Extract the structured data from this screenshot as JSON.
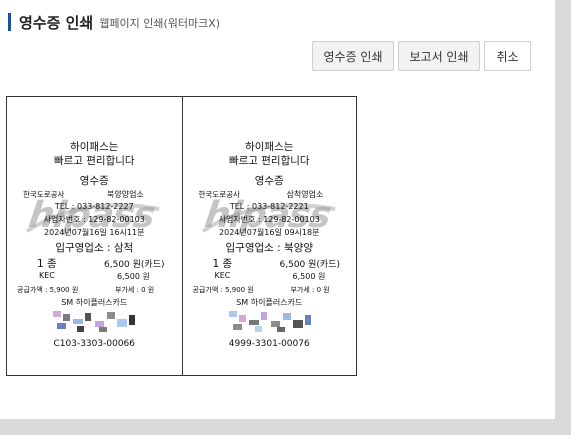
{
  "header": {
    "title": "영수증 인쇄",
    "subtitle": "웹페이지 인쇄(워터마크X)"
  },
  "toolbar": {
    "receipt_print": "영수증 인쇄",
    "report_print": "보고서 인쇄",
    "cancel": "취소"
  },
  "receipts": [
    {
      "slogan1": "하이패스는",
      "slogan2": "빠르고 편리합니다",
      "doc_title": "영수증",
      "company": "한국도로공사",
      "office": "북양양업소",
      "tel": "TEL : 033-812-2227",
      "bizno": "사업자번호 : 129-82-00103",
      "datetime": "2024년07월16일 16시11분",
      "entry": "입구영업소 : 삼척",
      "class": "1 종",
      "amount": "6,500 원(카드)",
      "issuer": "KEC",
      "issuer_amount": "6,500 원",
      "supply": "공급가액 : 5,900 원",
      "vat": "부가세 : 0 원",
      "card": "SM 하이플러스카드",
      "serial": "C103-3303-00066"
    },
    {
      "slogan1": "하이패스는",
      "slogan2": "빠르고 편리합니다",
      "doc_title": "영수증",
      "company": "한국도로공사",
      "office": "삼척영업소",
      "tel": "TEL : 033-812-2221",
      "bizno": "사업자번호 : 129-82-00103",
      "datetime": "2024년07월16일 09시18분",
      "entry": "입구영업소 : 북양양",
      "class": "1 종",
      "amount": "6,500 원(카드)",
      "issuer": "KEC",
      "issuer_amount": "6,500 원",
      "supply": "공급가액 : 5,900 원",
      "vat": "부가세 : 0 원",
      "card": "SM 하이플러스카드",
      "serial": "4999-3301-00076"
    }
  ],
  "watermark": "hipass"
}
